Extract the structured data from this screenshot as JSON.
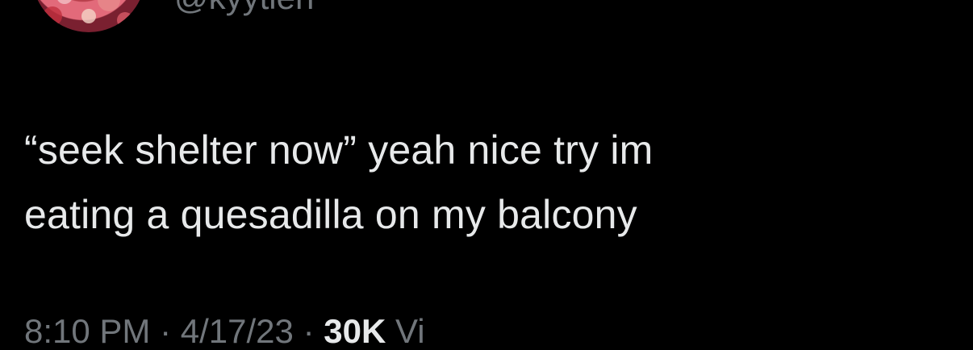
{
  "tweet": {
    "handle": "@kyytlen",
    "text": "“seek shelter now” yeah nice try im\neating a quesadilla on my balcony",
    "time": "8:10 PM",
    "separator": "·",
    "date": "4/17/23",
    "views_count": "30K",
    "views_label": "Vi"
  },
  "avatar": {
    "icon": "profile-photo"
  },
  "colors": {
    "background": "#000000",
    "text": "#e7e9ea",
    "secondary": "#71767b"
  }
}
